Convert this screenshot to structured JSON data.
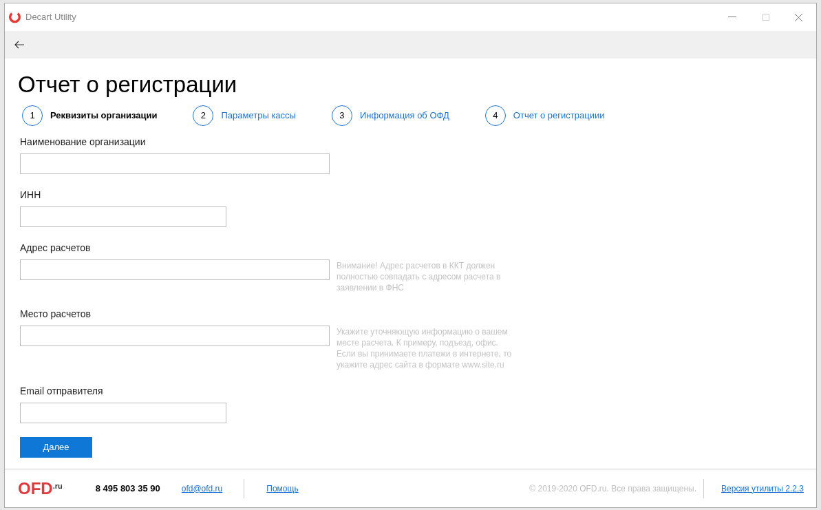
{
  "window": {
    "title": "Decart Utility"
  },
  "page_title": "Отчет о регистрации",
  "steps": [
    {
      "number": "1",
      "label": "Реквизиты организации",
      "selected": true
    },
    {
      "number": "2",
      "label": "Параметры кассы",
      "selected": false
    },
    {
      "number": "3",
      "label": "Информация об ОФД",
      "selected": false
    },
    {
      "number": "4",
      "label": "Отчет о регистрациии",
      "selected": false
    }
  ],
  "fields": [
    {
      "label": "Наименование организации",
      "kind": "long"
    },
    {
      "label": "ИНН",
      "kind": "short"
    },
    {
      "label": "Адрес расчетов",
      "kind": "long",
      "hint": "Внимание! Адрес расчетов в ККТ должен полностью совпадать с адресом расчета в заявлении в ФНС"
    },
    {
      "label": "Место расчетов",
      "kind": "long",
      "hint": "Укажите уточняющую информацию о вашем месте расчета. К примеру, подъезд, офис. Если вы принимаете платежи в интернете, то укажите адрес сайта в формате www.site.ru"
    },
    {
      "label": "Email отправителя",
      "kind": "short"
    }
  ],
  "next_button": "Далее",
  "footer": {
    "logo": "OFD",
    "logo_suffix": ".ru",
    "phone": "8 495 803 35 90",
    "email": "ofd@ofd.ru",
    "help": "Помощь",
    "copyright": "© 2019-2020 OFD.ru. Все права защищены.",
    "version": "Версия утилиты 2.2.3"
  }
}
